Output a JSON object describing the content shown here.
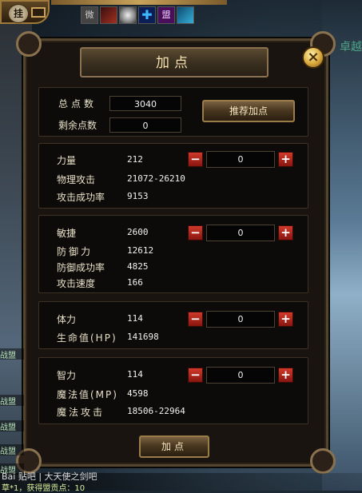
{
  "hud": {
    "hang_label": "挂",
    "buffs": [
      {
        "icon": "wei-icon",
        "text": "微"
      },
      {
        "icon": "sword-icon",
        "text": ""
      },
      {
        "icon": "orb-icon",
        "text": ""
      },
      {
        "icon": "cross-icon",
        "text": "✚"
      },
      {
        "icon": "meng-icon",
        "text": "盟"
      },
      {
        "icon": "crown-icon",
        "text": ""
      }
    ],
    "bg_text": "卓越"
  },
  "dialog": {
    "title": "加点",
    "close_label": "×",
    "total_label": "总点数",
    "total_value": "3040",
    "remaining_label": "剩余点数",
    "remaining_value": "0",
    "recommend_label": "推荐加点",
    "submit_label": "加点"
  },
  "stats": [
    {
      "name": "力量",
      "value": "212",
      "alloc": "0",
      "derived": [
        {
          "label": "物理攻击",
          "value": "21072-26210"
        },
        {
          "label": "攻击成功率",
          "value": "9153"
        }
      ]
    },
    {
      "name": "敏捷",
      "value": "2600",
      "alloc": "0",
      "derived": [
        {
          "label": "防御力",
          "value": "12612"
        },
        {
          "label": "防御成功率",
          "value": "4825"
        },
        {
          "label": "攻击速度",
          "value": "166"
        }
      ]
    },
    {
      "name": "体力",
      "value": "114",
      "alloc": "0",
      "derived": [
        {
          "label": "生命值(HP)",
          "value": "141698"
        }
      ]
    },
    {
      "name": "智力",
      "value": "114",
      "alloc": "0",
      "derived": [
        {
          "label": "魔法值(MP)",
          "value": "4598"
        },
        {
          "label": "魔法攻击",
          "value": "18506-22964"
        }
      ]
    }
  ],
  "chat": {
    "lines": [
      "战盟",
      "战盟",
      "战盟",
      "战盟",
      "战盟"
    ],
    "footer": "草*1，获得盟贡点：10",
    "watermark": "Bai 贴吧 | 大天使之剑吧"
  },
  "colors": {
    "panel_bg": "#1a1410",
    "border_gold": "#9a7c48",
    "minus_red": "#d03a2a",
    "text_cream": "#e8e0c8"
  }
}
